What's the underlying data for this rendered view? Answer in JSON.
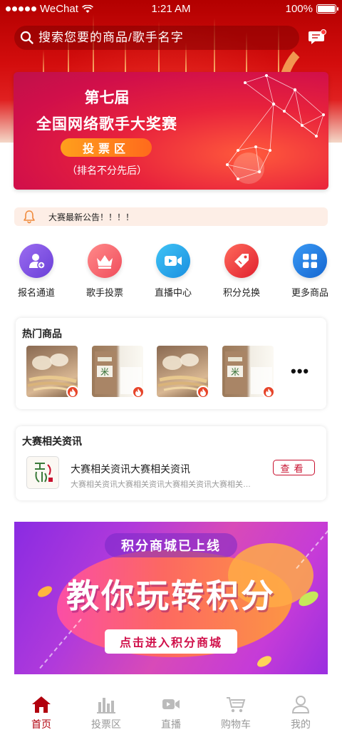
{
  "status_bar": {
    "carrier": "WeChat",
    "time": "1:21 AM",
    "battery": "100%"
  },
  "search": {
    "placeholder": "搜索您要的商品/歌手名字"
  },
  "banner": {
    "line1": "第七届",
    "line2": "全国网络歌手大奖赛",
    "button": "投票区",
    "line3": "（排名不分先后）"
  },
  "notice": {
    "text": "大赛最新公告！！！！"
  },
  "quick_nav": [
    {
      "label": "报名通道",
      "icon": "person-add-icon",
      "color": "#7b4fe0"
    },
    {
      "label": "歌手投票",
      "icon": "crown-icon",
      "color": "#ff6b6b"
    },
    {
      "label": "直播中心",
      "icon": "video-camera-icon",
      "color": "#1fa3e8"
    },
    {
      "label": "积分兑换",
      "icon": "tag-icon",
      "color": "#ef3b3b"
    },
    {
      "label": "更多商品",
      "icon": "grid-icon",
      "color": "#1f7fe0"
    }
  ],
  "hot_products": {
    "title": "热门商品",
    "items": [
      {
        "kind": "ginseng",
        "badge": "fire-icon"
      },
      {
        "kind": "rice",
        "badge": "fire-icon",
        "package_text": "米"
      },
      {
        "kind": "ginseng",
        "badge": "fire-icon"
      },
      {
        "kind": "rice",
        "badge": "fire-icon",
        "package_text": "米"
      }
    ],
    "more": "•••"
  },
  "news": {
    "title": "大赛相关资讯",
    "item_title": "大赛相关资讯大赛相关资讯",
    "item_subtitle": "大赛相关资讯大赛相关资讯大赛相关资讯大赛相关资讯大赛相关资讯",
    "view_button": "查看"
  },
  "promo": {
    "top": "积分商城已上线",
    "headline": "教你玩转积分",
    "button": "点击进入积分商城"
  },
  "tabbar": [
    {
      "label": "首页",
      "icon": "home-icon",
      "active": true
    },
    {
      "label": "投票区",
      "icon": "bar-chart-icon",
      "active": false
    },
    {
      "label": "直播",
      "icon": "video-icon",
      "active": false
    },
    {
      "label": "购物车",
      "icon": "cart-icon",
      "active": false
    },
    {
      "label": "我的",
      "icon": "user-icon",
      "active": false
    }
  ],
  "colors": {
    "brand_red": "#b1000d",
    "accent_orange": "#ff8a1c",
    "inactive_gray": "#999999"
  }
}
